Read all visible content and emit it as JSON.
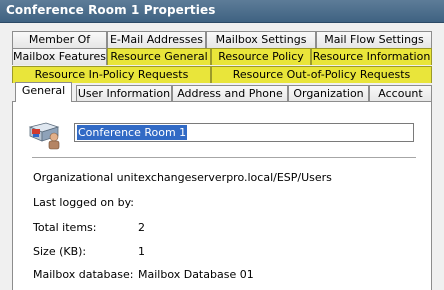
{
  "window": {
    "title": "Conference Room 1 Properties"
  },
  "tabs": {
    "row1": [
      "Member Of",
      "E-Mail Addresses",
      "Mailbox Settings",
      "Mail Flow Settings"
    ],
    "row2": [
      "Mailbox Features",
      "Resource General",
      "Resource Policy",
      "Resource Information"
    ],
    "row3": [
      "Resource In-Policy Requests",
      "Resource Out-of-Policy Requests"
    ],
    "row4": [
      "General",
      "User Information",
      "Address and Phone",
      "Organization",
      "Account"
    ],
    "selected": "General",
    "highlight_color": "#e9e53a"
  },
  "general": {
    "display_name": "Conference Room 1",
    "fields": [
      {
        "label": "Organizational unit:",
        "value": "exchangeserverpro.local/ESP/Users"
      },
      {
        "label": "Last logged on by:",
        "value": ""
      },
      {
        "label": "Total items:",
        "value": "2"
      },
      {
        "label": "Size (KB):",
        "value": "1"
      },
      {
        "label": "Mailbox database:",
        "value": "Mailbox Database 01"
      }
    ]
  },
  "icons": {
    "room": "conference-room-mailbox-icon"
  }
}
